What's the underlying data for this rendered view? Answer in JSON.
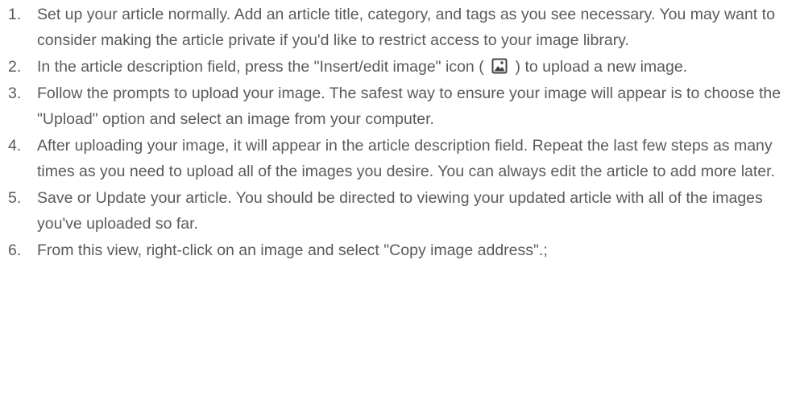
{
  "steps": [
    {
      "number": "1.",
      "text": "Set up your article normally. Add an article title, category, and tags as you see necessary. You may want to consider making the article private if you'd like to restrict access to your image library."
    },
    {
      "number": "2.",
      "text_before": "In the article description field, press the \"Insert/edit image\" icon (",
      "icon": "image-icon",
      "text_after": ") to upload a new image."
    },
    {
      "number": "3.",
      "text": "Follow the prompts to upload your image. The safest way to ensure your image will appear is to choose the \"Upload\" option and select an image from your computer."
    },
    {
      "number": "4.",
      "text": "After uploading your image, it will appear in the article description field. Repeat the last few steps as many times as you need to upload all of the images you desire. You can always edit the article to add more later."
    },
    {
      "number": "5.",
      "text": "Save or Update your article. You should be directed to viewing your updated article with all of the images you've uploaded so far."
    },
    {
      "number": "6.",
      "text": "From this view, right-click on an image and select \"Copy image address\".;"
    }
  ],
  "colors": {
    "text": "#5a5a5a",
    "icon": "#444444"
  }
}
